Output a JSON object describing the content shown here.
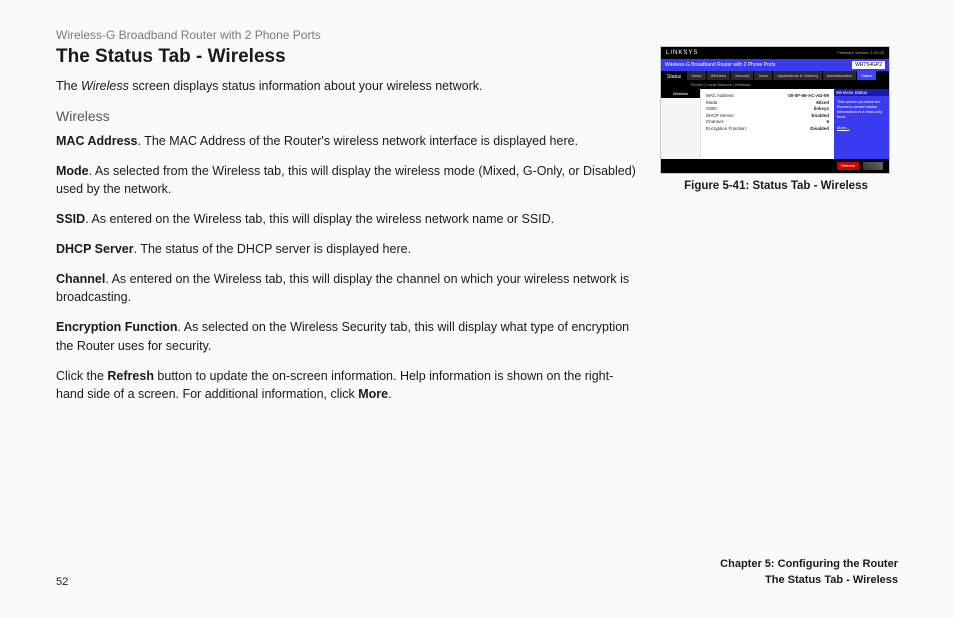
{
  "header_sub": "Wireless-G Broadband Router with 2 Phone Ports",
  "title": "The Status Tab - Wireless",
  "intro_prefix": "The ",
  "intro_italic": "Wireless",
  "intro_suffix": " screen displays status information about your wireless network.",
  "subhead": "Wireless",
  "defs": [
    {
      "term": "MAC Address",
      "text": ". The MAC Address of the Router's wireless network interface is displayed here."
    },
    {
      "term": "Mode",
      "text": ". As selected from the Wireless tab, this will display the wireless mode (Mixed, G-Only, or Disabled) used by the network."
    },
    {
      "term": "SSID",
      "text": ". As entered on the Wireless tab, this will display the wireless network name or SSID."
    },
    {
      "term": "DHCP Server",
      "text": ". The status of the DHCP server is displayed here."
    },
    {
      "term": "Channel",
      "text": ". As entered on the Wireless tab, this will display the channel on which your wireless network is broadcasting."
    },
    {
      "term": "Encryption Function",
      "text": ". As selected on the Wireless Security tab, this will display what type of encryption the Router uses for security."
    }
  ],
  "closing_p1a": "Click the ",
  "closing_p1b": "Refresh",
  "closing_p1c": " button to update the on-screen information. Help information is shown on the right-hand side of a screen. For additional information, click ",
  "closing_p1d": "More",
  "closing_p1e": ".",
  "figure": {
    "brand": "LINKSYS",
    "fv": "Firmware Version: 1.00.00",
    "bar_title": "Wireless-G Broadband Router with 2 Phone Ports",
    "bar_model": "WRT54GP2",
    "status_label": "Status",
    "tabs": [
      "Setup",
      "Wireless",
      "Security",
      "Voice",
      "Applications & Gaming",
      "Administration",
      "Status"
    ],
    "subtabs": "Router | Local Network | Wireless",
    "side_head": "Wireless",
    "rows": [
      {
        "k": "MAC Address:",
        "v": "00-0F-66-AC-AD-99"
      },
      {
        "k": "Mode:",
        "v": "Mixed"
      },
      {
        "k": "SSID:",
        "v": "linksys"
      },
      {
        "k": "DHCP Server:",
        "v": "Enabled"
      },
      {
        "k": "Channel:",
        "v": "6"
      },
      {
        "k": "Encryption Function:",
        "v": "Disabled"
      }
    ],
    "help_head": "Wireless Status",
    "help_line1": "This screen provides the",
    "help_line2": "Router's current status",
    "help_line3": "information in a read-only form.",
    "more": "More...",
    "refresh": "Refresh"
  },
  "fig_caption": "Figure 5-41: Status Tab - Wireless",
  "footer": {
    "page": "52",
    "chapter": "Chapter 5: Configuring the Router",
    "section": "The Status Tab - Wireless"
  }
}
